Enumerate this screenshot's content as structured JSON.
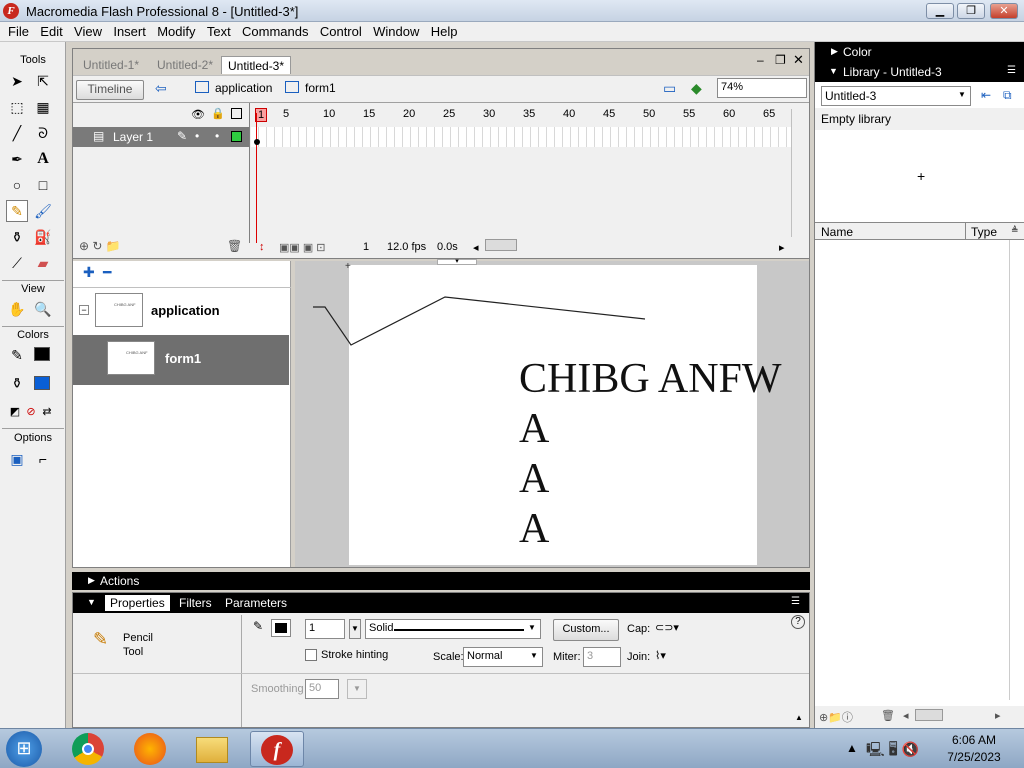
{
  "window": {
    "title": "Macromedia Flash Professional 8 - [Untitled-3*]",
    "icon": "F"
  },
  "menu": [
    "File",
    "Edit",
    "View",
    "Insert",
    "Modify",
    "Text",
    "Commands",
    "Control",
    "Window",
    "Help"
  ],
  "tools": {
    "header": "Tools",
    "view_header": "View",
    "colors_header": "Colors",
    "options_header": "Options"
  },
  "doc_tabs": [
    "Untitled-1*",
    "Untitled-2*",
    "Untitled-3*"
  ],
  "editbar": {
    "timeline_button": "Timeline",
    "crumbs": [
      "application",
      "form1"
    ],
    "zoom": "74%"
  },
  "timeline": {
    "layer": "Layer 1",
    "frame_numbers": [
      "1",
      "5",
      "10",
      "15",
      "20",
      "25",
      "30",
      "35",
      "40",
      "45",
      "50",
      "55",
      "60",
      "65"
    ],
    "current_frame": "1",
    "fps": "12.0 fps",
    "time": "0.0s"
  },
  "screens": {
    "items": [
      {
        "label": "application"
      },
      {
        "label": "form1"
      }
    ],
    "thumb_text": "CHIBG ANF"
  },
  "stage": {
    "lines": [
      "CHIBG ANFW",
      "A",
      "A",
      "A"
    ]
  },
  "panels": {
    "actions": "Actions",
    "tabs": [
      "Properties",
      "Filters",
      "Parameters"
    ]
  },
  "properties": {
    "tool_name": "Pencil Tool",
    "stroke_width": "1",
    "stroke_style": "Solid",
    "custom_button": "Custom...",
    "cap_label": "Cap:",
    "stroke_hinting": "Stroke hinting",
    "scale_label": "Scale:",
    "scale_value": "Normal",
    "miter_label": "Miter:",
    "miter_value": "3",
    "join_label": "Join:",
    "smoothing_label": "Smoothing",
    "smoothing_value": "50"
  },
  "right_panel": {
    "color": "Color",
    "library_title": "Library - Untitled-3",
    "library_select": "Untitled-3",
    "empty": "Empty library",
    "col_name": "Name",
    "col_type": "Type"
  },
  "taskbar": {
    "time": "6:06 AM",
    "date": "7/25/2023"
  },
  "colors": {
    "accent": "#c8281e",
    "selected_row": "#6f6f6f",
    "stroke": "#000000",
    "fill": "#0a5fd6"
  }
}
